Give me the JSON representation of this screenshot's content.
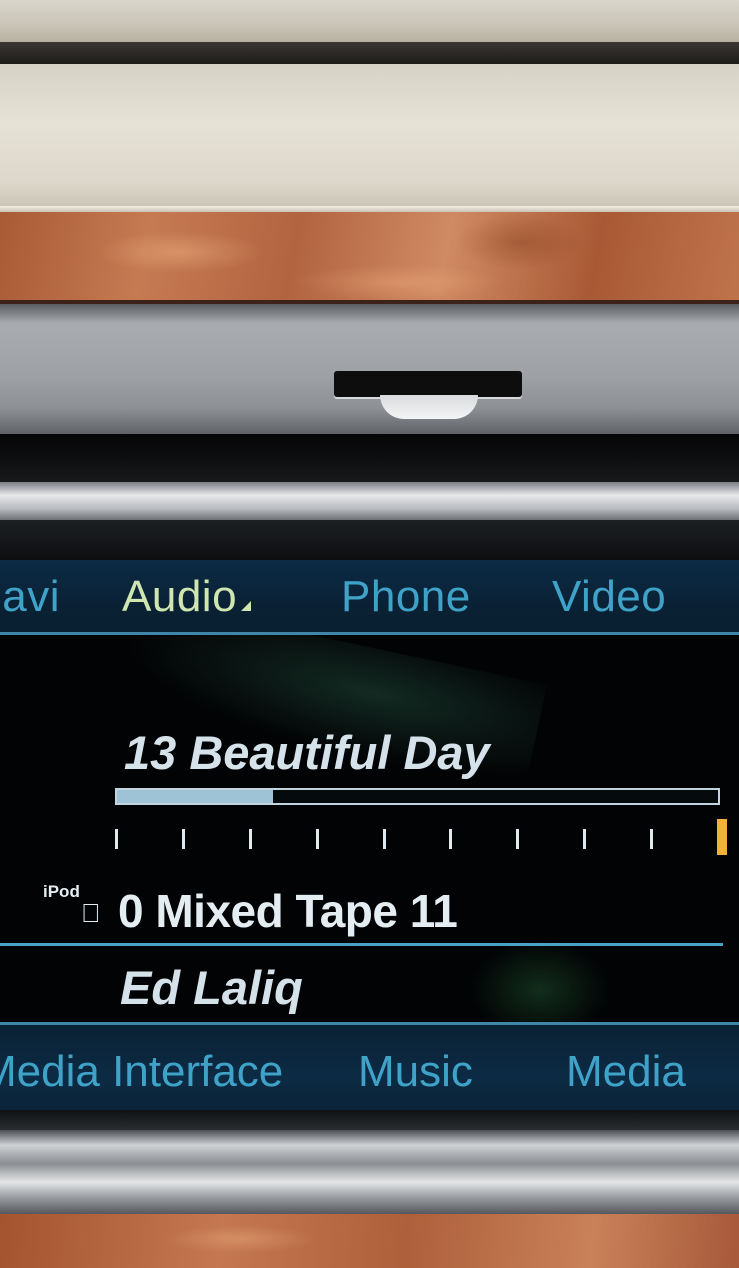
{
  "top_menu": {
    "items": [
      {
        "label": "Navi",
        "state": "inactive"
      },
      {
        "label": "Audio",
        "state": "active"
      },
      {
        "label": "Phone",
        "state": "inactive"
      },
      {
        "label": "Video",
        "state": "inactive"
      }
    ]
  },
  "now_playing": {
    "track": "13 Beautiful Day",
    "progress_fraction": 0.26,
    "track_marker_count": 10,
    "current_marker_index": 9,
    "source_logo": "iPod",
    "album": "0 Mixed Tape 11",
    "artist": "Ed Laliq"
  },
  "bottom_menu": {
    "items": [
      {
        "label": "Media Interface"
      },
      {
        "label": "Music"
      },
      {
        "label": "Media"
      }
    ]
  },
  "colors": {
    "menu_text": "#3fa3c9",
    "active_menu_text": "#cfe6b0",
    "marker_current": "#f2b233",
    "screen_bg": "#020305"
  }
}
